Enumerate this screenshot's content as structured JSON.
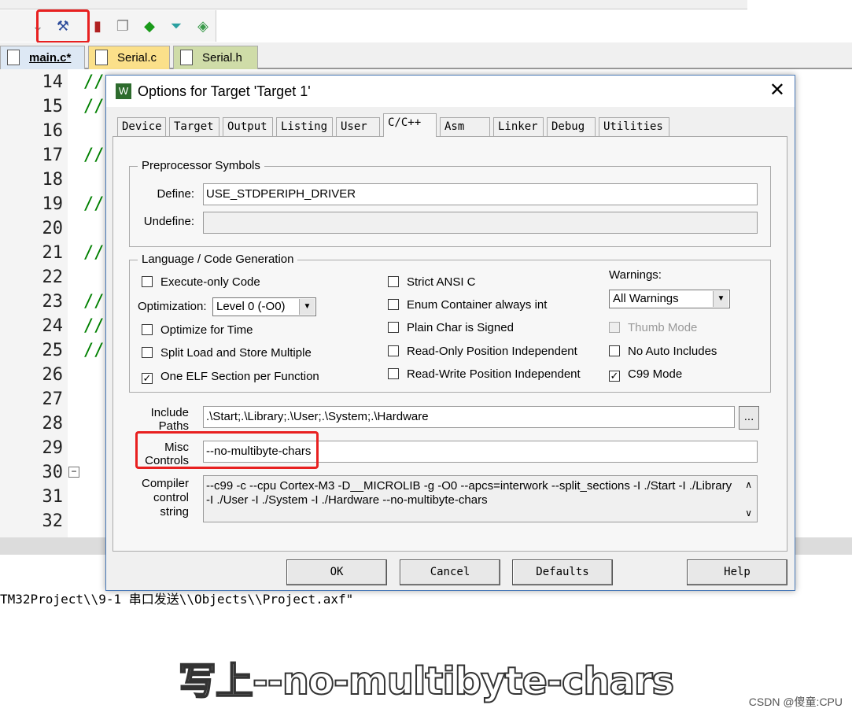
{
  "file_tabs": [
    {
      "label": "main.c*"
    },
    {
      "label": "Serial.c"
    },
    {
      "label": "Serial.h"
    }
  ],
  "toolbar_icons": [
    "options-for-target-icon",
    "manage-project-icon",
    "copy-icon",
    "run-icon",
    "filter-icon",
    "pack-installer-icon"
  ],
  "editor": {
    "lines": [
      {
        "n": "14",
        "c": "//"
      },
      {
        "n": "15",
        "c": "//"
      },
      {
        "n": "16",
        "c": ""
      },
      {
        "n": "17",
        "c": "//"
      },
      {
        "n": "18",
        "c": ""
      },
      {
        "n": "19",
        "c": "//"
      },
      {
        "n": "20",
        "c": ""
      },
      {
        "n": "21",
        "c": "//"
      },
      {
        "n": "22",
        "c": ""
      },
      {
        "n": "23",
        "c": "//"
      },
      {
        "n": "24",
        "c": "//"
      },
      {
        "n": "25",
        "c": "//"
      },
      {
        "n": "26",
        "c": ""
      },
      {
        "n": "27",
        "c": ""
      },
      {
        "n": "28",
        "c": ""
      },
      {
        "n": "29",
        "c": ""
      },
      {
        "n": "30",
        "c": ""
      },
      {
        "n": "31",
        "c": ""
      },
      {
        "n": "32",
        "c": ""
      }
    ]
  },
  "output_text": "TM32Project\\\\9-1 串口发送\\\\Objects\\\\Project.axf\"",
  "subtitle": "写上--no-multibyte-chars",
  "watermark": "CSDN @傻童:CPU",
  "dialog": {
    "title": "Options for Target 'Target 1'",
    "tabs": [
      "Device",
      "Target",
      "Output",
      "Listing",
      "User",
      "C/C++",
      "Asm",
      "Linker",
      "Debug",
      "Utilities"
    ],
    "active_tab": "C/C++",
    "preprocessor": {
      "label": "Preprocessor Symbols",
      "define_label": "Define:",
      "define_value": "USE_STDPERIPH_DRIVER",
      "undefine_label": "Undefine:",
      "undefine_value": ""
    },
    "language": {
      "label": "Language / Code Generation",
      "checks_col1": [
        {
          "label": "Execute-only Code",
          "checked": false
        },
        {
          "label": "Optimize for Time",
          "checked": false
        },
        {
          "label": "Split Load and Store Multiple",
          "checked": false
        },
        {
          "label": "One ELF Section per Function",
          "checked": true
        }
      ],
      "optimization_label": "Optimization:",
      "optimization_value": "Level 0 (-O0)",
      "checks_col2": [
        {
          "label": "Strict ANSI C",
          "checked": false
        },
        {
          "label": "Enum Container always int",
          "checked": false
        },
        {
          "label": "Plain Char is Signed",
          "checked": false
        },
        {
          "label": "Read-Only Position Independent",
          "checked": false
        },
        {
          "label": "Read-Write Position Independent",
          "checked": false
        }
      ],
      "warnings_label": "Warnings:",
      "warnings_value": "All Warnings",
      "checks_col3": [
        {
          "label": "Thumb Mode",
          "checked": false,
          "disabled": true
        },
        {
          "label": "No Auto Includes",
          "checked": false
        },
        {
          "label": "C99 Mode",
          "checked": true
        }
      ]
    },
    "include_label": "Include Paths",
    "include_value": ".\\Start;.\\Library;.\\User;.\\System;.\\Hardware",
    "browse_label": "...",
    "misc_label": "Misc Controls",
    "misc_value": "--no-multibyte-chars",
    "compiler_label": "Compiler control string",
    "compiler_value": "--c99 -c --cpu Cortex-M3 -D__MICROLIB -g -O0 --apcs=interwork --split_sections -I ./Start -I ./Library -I ./User -I ./System -I ./Hardware --no-multibyte-chars",
    "buttons": {
      "ok": "OK",
      "cancel": "Cancel",
      "defaults": "Defaults",
      "help": "Help"
    }
  },
  "colors": {
    "highlight": "#e82020",
    "serial_c_tab": "#fbe08a",
    "serial_h_tab": "#cfdca8",
    "main_tab": "#dde8f4"
  }
}
